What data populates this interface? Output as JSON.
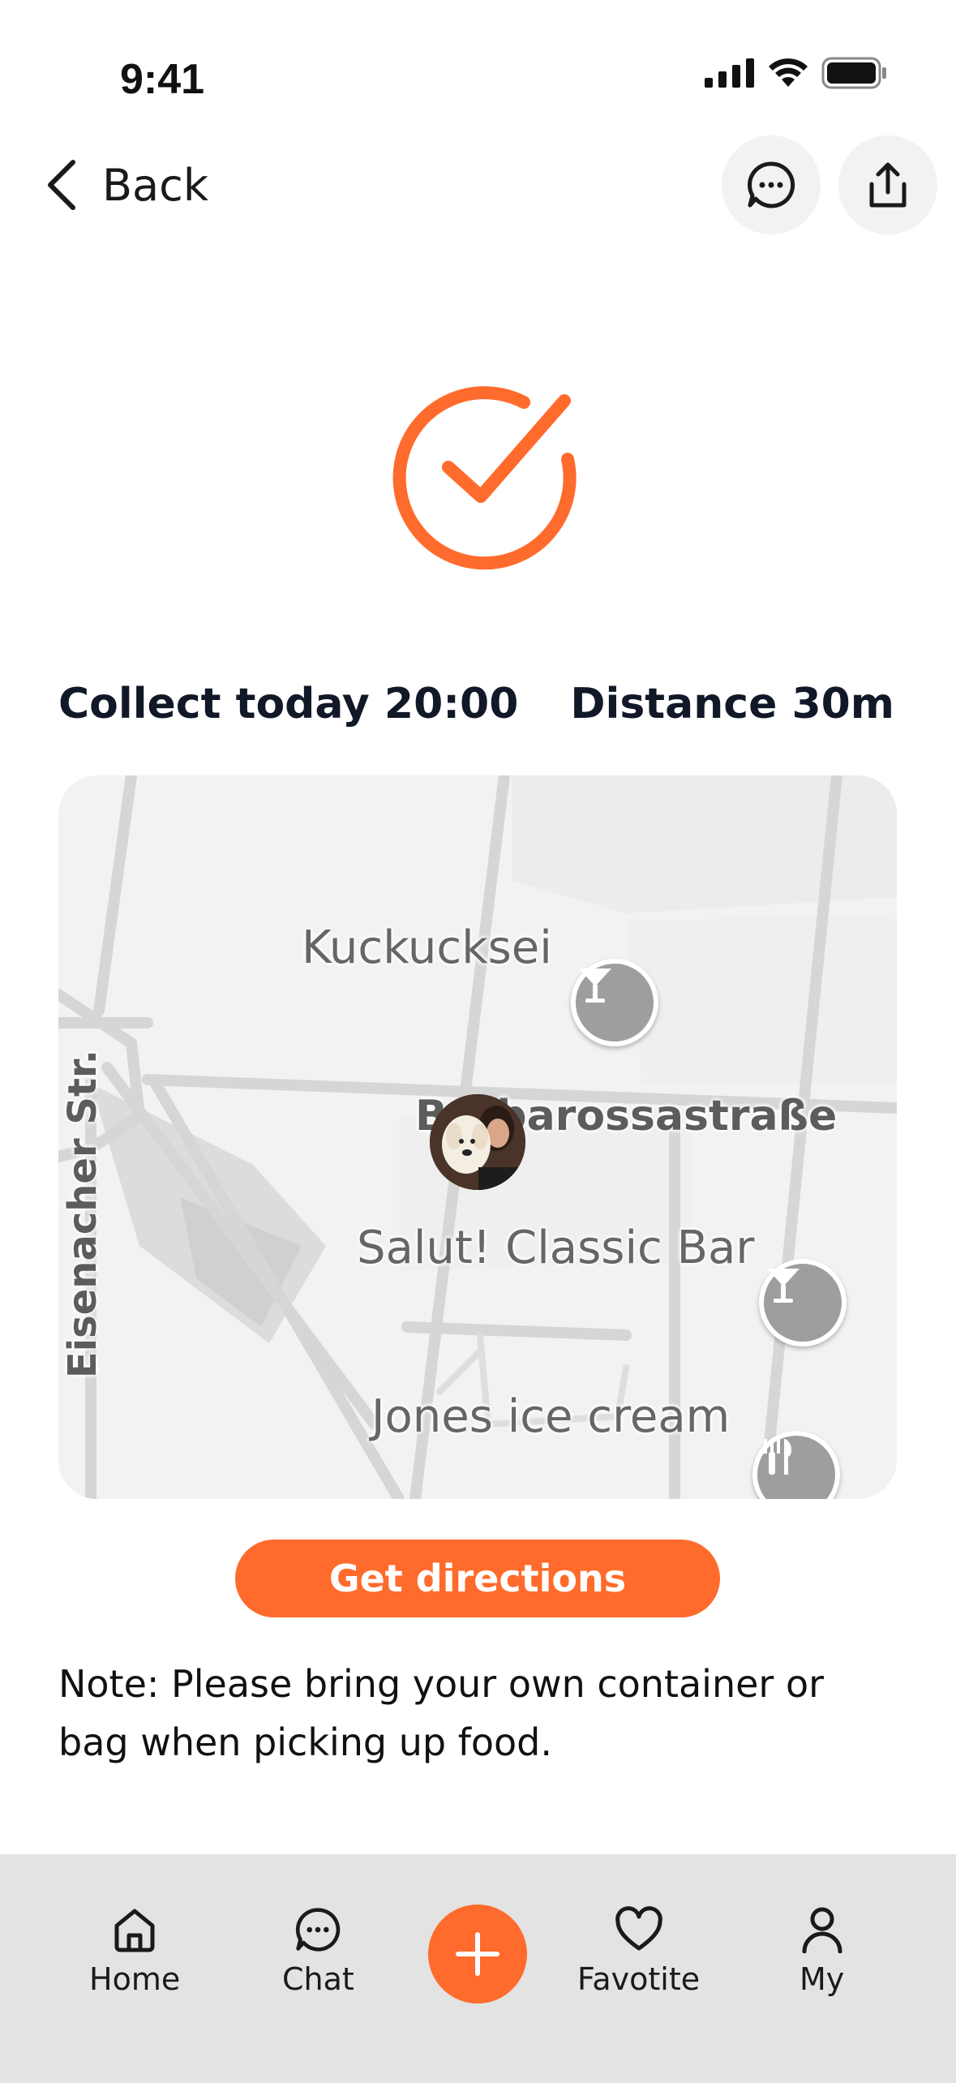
{
  "status_bar": {
    "time": "9:41"
  },
  "nav": {
    "back_label": "Back",
    "chat_icon": "chat-bubble-icon",
    "share_icon": "share-icon"
  },
  "success_icon": "check-circle-icon",
  "info": {
    "collect": "Collect today 20:00",
    "distance": "Distance 30m"
  },
  "map": {
    "places": [
      {
        "name": "Kuckucksei",
        "icon": "cocktail-icon"
      },
      {
        "name": "Barbarossastraße",
        "icon": ""
      },
      {
        "name": "Salut! Classic Bar",
        "icon": "cocktail-icon"
      },
      {
        "name": "Jones ice cream",
        "icon": "restaurant-icon"
      },
      {
        "name": "Eisenacher Str.",
        "icon": ""
      }
    ]
  },
  "cta": {
    "label": "Get directions"
  },
  "note": "Note: Please bring your own container or bag when picking up food.",
  "tabbar": {
    "items": [
      {
        "label": "Home",
        "icon": "home-icon"
      },
      {
        "label": "Chat",
        "icon": "chat-icon"
      },
      {
        "label": "",
        "icon": "plus-icon"
      },
      {
        "label": "Favotite",
        "icon": "heart-icon"
      },
      {
        "label": "My",
        "icon": "user-icon"
      }
    ]
  },
  "colors": {
    "accent": "#ff6b2c",
    "tabbar_bg": "#e3e3e3",
    "text_dark": "#111827"
  }
}
